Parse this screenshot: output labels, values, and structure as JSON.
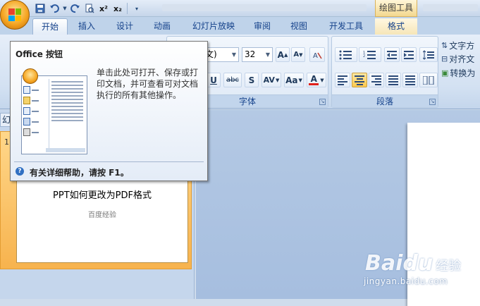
{
  "titlebar": {
    "tools_tab": "绘图工具",
    "qat": [
      "save-icon",
      "undo-icon",
      "redo-icon",
      "print-preview-icon",
      "superscript-icon",
      "subscript-icon",
      "customize-icon"
    ],
    "superscript": "x²",
    "subscript": "x₂"
  },
  "tabs": [
    {
      "label": "开始",
      "active": true
    },
    {
      "label": "插入"
    },
    {
      "label": "设计"
    },
    {
      "label": "动画"
    },
    {
      "label": "幻灯片放映"
    },
    {
      "label": "审阅"
    },
    {
      "label": "视图"
    },
    {
      "label": "开发工具"
    },
    {
      "label": "格式",
      "contextual": true
    }
  ],
  "ribbon": {
    "font_group_label": "字体",
    "paragraph_group_label": "段落",
    "font_name_partial": "文)",
    "font_size": "32",
    "grow_font": "A",
    "shrink_font": "A",
    "underline": "U",
    "strikethrough": "abc",
    "shadow": "S",
    "char_spacing": "AV",
    "change_case": "Aa",
    "font_color": "A",
    "text_direction": "文字方",
    "align_text": "对齐文",
    "convert_smartart": "转换为"
  },
  "tooltip": {
    "title": "Office 按钮",
    "description": "单击此处可打开、保存或打印文档，并可查看可对文档执行的所有其他操作。",
    "help": "有关详细帮助，请按 F1。"
  },
  "slides_panel": {
    "tab_label": "幻",
    "slide_number": "1",
    "slide_title": "PPT如何更改为PDF格式",
    "slide_subtitle": "百度经验"
  },
  "watermark": {
    "brand": "Baidu",
    "brand_cn": "经验",
    "url": "jingyan.baidu.com"
  },
  "colors": {
    "ribbon_bg": "#d3e1f2",
    "accent_orange": "#f5a623",
    "font_color_bar": "#e0201b"
  }
}
